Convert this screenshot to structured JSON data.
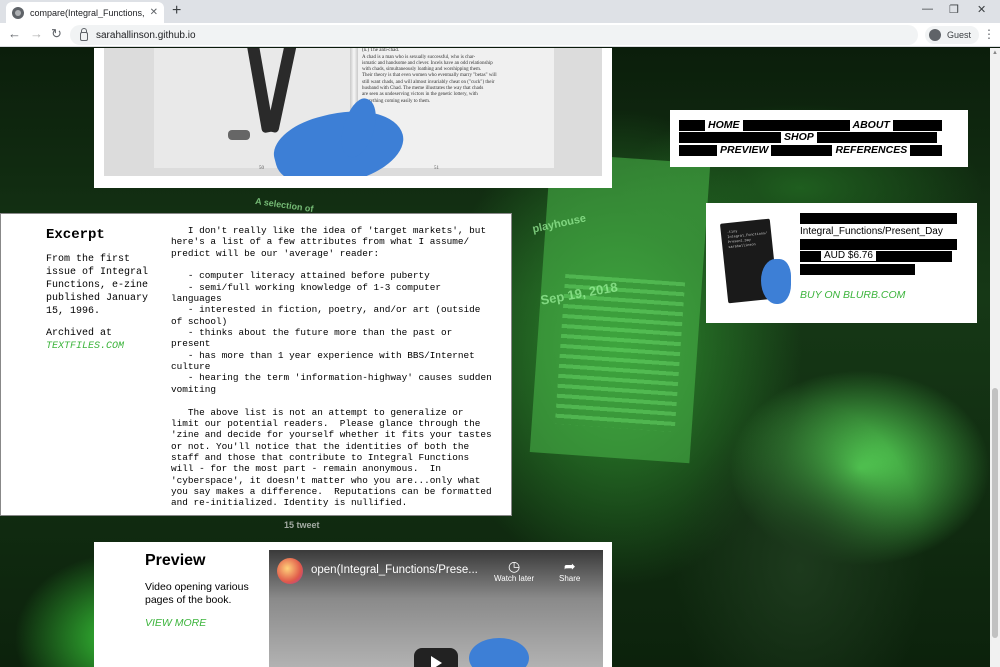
{
  "browser": {
    "tab_title": "compare(Integral_Functions, Pres",
    "tab_close": "✕",
    "new_tab": "+",
    "url": "sarahallinson.github.io",
    "profile_label": "Guest",
    "window_minimize": "—",
    "window_restore": "❐",
    "window_close": "✕",
    "back": "←",
    "forward": "→",
    "reload": "↻",
    "menu": "⋮"
  },
  "nav": {
    "home": "HOME",
    "about": "ABOUT",
    "shop": "SHOP",
    "preview": "PREVIEW",
    "references": "REFERENCES"
  },
  "shop": {
    "product_title": "Integral_Functions/Present_Day",
    "price": "AUD $6.76",
    "buy_link": "BUY ON BLURB.COM",
    "zine_cover_text": ".tiny\nIntegral_Functions/\nPresent_Day\nsarahallinson"
  },
  "book_photo": {
    "page_text": "Incel\n(n.) The anti-chad.\nA chad is a man who is sexually successful, who is char-\nismatic and handsome and clever. Incels have an odd relationship\nwith chads, simultaneously loathing and worshipping them.\nTheir theory is that even women who eventually marry \"betas\" will\nstill want chads, and will almost invariably cheat on (\"cuck\") their\nhusband with Chad. The meme illustrates the way that chads\nare seen as undeserving victors in the genetic lottery, with\neverything coming easily to them.",
    "left_page_number": "50",
    "right_page_number": "51"
  },
  "excerpt": {
    "title": "Excerpt",
    "source": "From the first issue of Integral Functions, e-zine published January 15, 1996.",
    "archived_label": "Archived at",
    "archived_link": "TEXTFILES.COM",
    "body": "   I don't really like the idea of 'target markets', but\nhere's a list of a few attributes from what I assume/\npredict will be our 'average' reader:\n\n   - computer literacy attained before puberty\n   - semi/full working knowledge of 1-3 computer\nlanguages\n   - interested in fiction, poetry, and/or art (outside\nof school)\n   - thinks about the future more than the past or\npresent\n   - has more than 1 year experience with BBS/Internet\nculture\n   - hearing the term 'information-highway' causes sudden\nvomiting\n\n   The above list is not an attempt to generalize or\nlimit our potential readers.  Please glance through the\n'zine and decide for yourself whether it fits your tastes\nor not. You'll notice that the identities of both the\nstaff and those that contribute to Integral Functions\nwill - for the most part - remain anonymous.  In\n'cyberspace', it doesn't matter who you are...only what\nyou say makes a difference.  Reputations can be formatted\nand re-initialized. Identity is nullified."
  },
  "preview": {
    "title": "Preview",
    "description": "Video opening various pages of the book.",
    "view_more": "VIEW MORE",
    "video_title": "open(Integral_Functions/Prese...",
    "watch_later": "Watch later",
    "share": "Share",
    "watch_later_icon": "◷",
    "share_icon": "➦"
  },
  "background_text": {
    "line1": "A selection of",
    "line2": "playhouse",
    "line3": "Sep 19, 2018",
    "line4": "15 tweet"
  },
  "colors": {
    "link_green": "#3cb43c",
    "background_green": "#2f8f2f",
    "glove_blue": "#3d7fd6"
  }
}
